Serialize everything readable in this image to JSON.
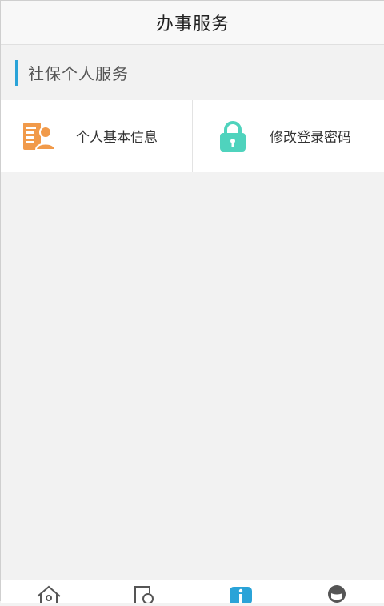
{
  "header": {
    "title": "办事服务"
  },
  "section": {
    "title": "社保个人服务"
  },
  "services": [
    {
      "label": "个人基本信息",
      "icon": "person-info-icon",
      "color": "#f19a4a"
    },
    {
      "label": "修改登录密码",
      "icon": "lock-icon",
      "color": "#4fd3bd"
    }
  ],
  "tabbar": {
    "tabs": [
      {
        "icon": "home-icon"
      },
      {
        "icon": "search-doc-icon"
      },
      {
        "icon": "info-icon",
        "active": true,
        "color": "#2aa3d8"
      },
      {
        "icon": "user-icon"
      }
    ]
  },
  "colors": {
    "accent": "#2aa3d8",
    "background": "#f2f2f2"
  }
}
